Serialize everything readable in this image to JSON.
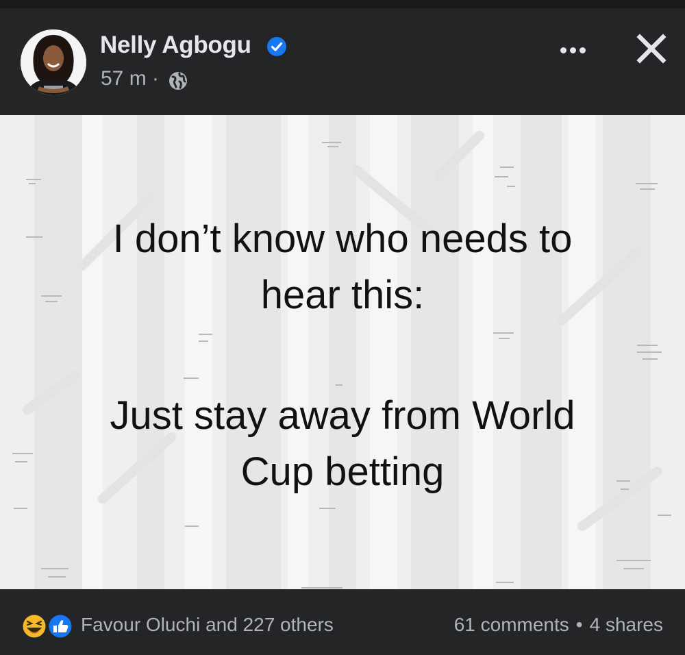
{
  "post": {
    "author": "Nelly Agbogu",
    "time": "57 m",
    "separator": "·",
    "text_line1": "I don’t know who needs to",
    "text_line2": "hear this:",
    "text_line3": "Just stay away from World",
    "text_line4": "Cup betting"
  },
  "reactions": {
    "summary": "Favour Oluchi and 227 others",
    "comments": "61 comments",
    "dot": "•",
    "shares": "4 shares"
  },
  "colors": {
    "background": "#242526",
    "verified": "#1877f2",
    "like": "#1877f2",
    "haha": "#f7b928"
  },
  "icons": [
    "verified-badge-icon",
    "globe-icon",
    "more-options-icon",
    "close-icon",
    "haha-reaction-icon",
    "like-reaction-icon"
  ]
}
